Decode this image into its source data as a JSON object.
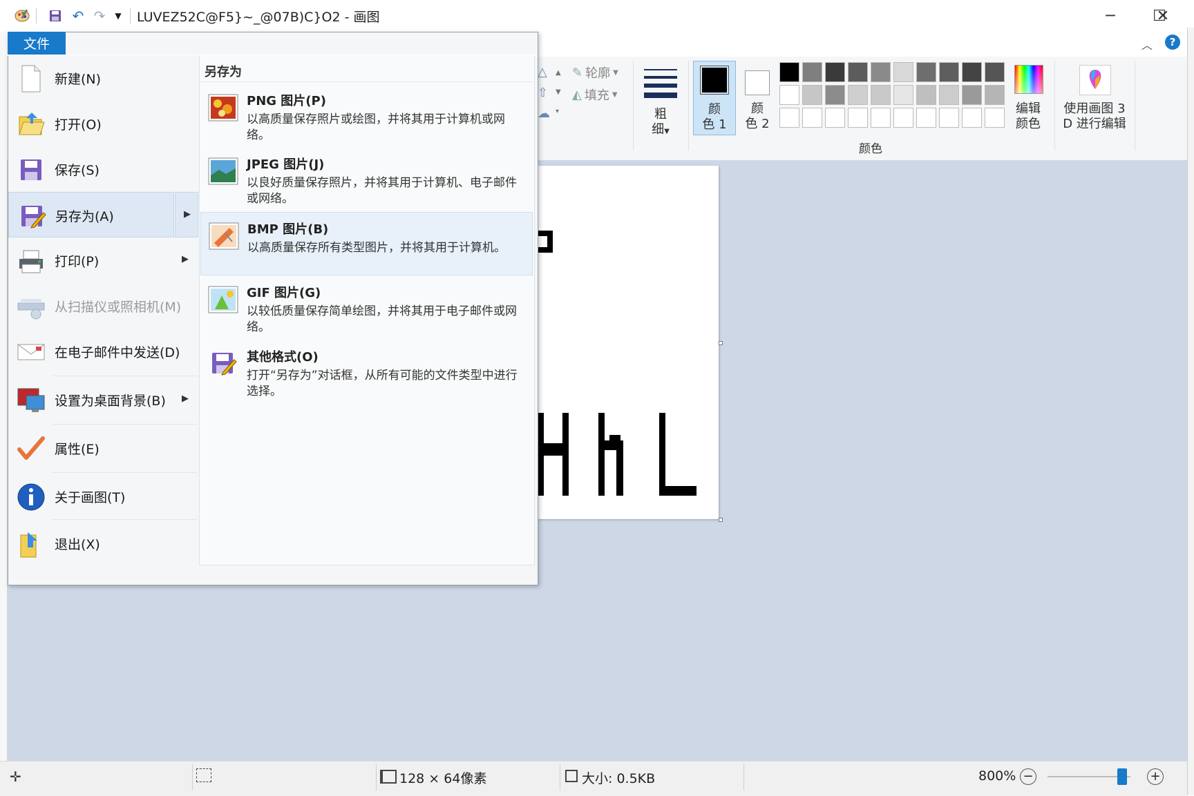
{
  "window": {
    "title": "LUVEZ52C@F5}~_@07B)C}O2 - 画图",
    "controls": {
      "minimize": "─",
      "maximize": "☐",
      "close": "✕"
    }
  },
  "quick_access": {
    "save_icon": "save-icon",
    "undo_icon": "undo-icon",
    "redo_icon": "redo-icon",
    "dropdown_icon": "chevron-down-icon"
  },
  "ribbon": {
    "file_tab": "文件",
    "shapes": {
      "outline_label": "轮廓",
      "fill_label": "填充"
    },
    "size_label_1": "粗",
    "size_label_2": "细",
    "color1_label_1": "颜",
    "color1_label_2": "色 1",
    "color2_label_1": "颜",
    "color2_label_2": "色 2",
    "colors_group_label": "颜色",
    "edit_colors_label_1": "编辑",
    "edit_colors_label_2": "颜色",
    "paint3d_label_1": "使用画图 3",
    "paint3d_label_2": "D 进行编辑",
    "color1": "#000000",
    "color2": "#ffffff",
    "palette_row1": [
      "#000000",
      "#7f7f7f",
      "#3a3a3a",
      "#5c5c5c",
      "#8a8a8a",
      "#d9d9d9",
      "#6e6e6e",
      "#5e5e5e",
      "#444444",
      "#555555"
    ],
    "palette_row2": [
      "#ffffff",
      "#c6c6c6",
      "#8c8c8c",
      "#cfcfcf",
      "#c9c9c9",
      "#e6e6e6",
      "#bfbfbf",
      "#cccccc",
      "#9a9a9a",
      "#b5b5b5"
    ]
  },
  "file_menu": {
    "items": [
      {
        "label": "新建(N)",
        "icon": "new-file-icon"
      },
      {
        "label": "打开(O)",
        "icon": "open-folder-icon"
      },
      {
        "label": "保存(S)",
        "icon": "save-icon"
      },
      {
        "label": "另存为(A)",
        "icon": "save-as-icon"
      },
      {
        "label": "打印(P)",
        "icon": "printer-icon"
      },
      {
        "label": "从扫描仪或照相机(M)",
        "icon": "scanner-icon"
      },
      {
        "label": "在电子邮件中发送(D)",
        "icon": "email-icon"
      },
      {
        "label": "设置为桌面背景(B)",
        "icon": "desktop-icon"
      },
      {
        "label": "属性(E)",
        "icon": "checkmark-icon"
      },
      {
        "label": "关于画图(T)",
        "icon": "info-icon"
      },
      {
        "label": "退出(X)",
        "icon": "exit-icon"
      }
    ],
    "submenu_header": "另存为",
    "save_as_options": [
      {
        "title": "PNG 图片(P)",
        "desc": "以高质量保存照片或绘图，并将其用于计算机或网络。"
      },
      {
        "title": "JPEG 图片(J)",
        "desc": "以良好质量保存照片，并将其用于计算机、电子邮件或网络。"
      },
      {
        "title": "BMP 图片(B)",
        "desc": "以高质量保存所有类型图片，并将其用于计算机。"
      },
      {
        "title": "GIF 图片(G)",
        "desc": "以较低质量保存简单绘图，并将其用于电子邮件或网络。"
      },
      {
        "title": "其他格式(O)",
        "desc": "打开“另存为”对话框，从所有可能的文件类型中进行选择。"
      }
    ]
  },
  "statusbar": {
    "dimensions": "128 × 64像素",
    "size": "大小: 0.5KB",
    "zoom": "800%",
    "zoom_level": 0.9
  }
}
